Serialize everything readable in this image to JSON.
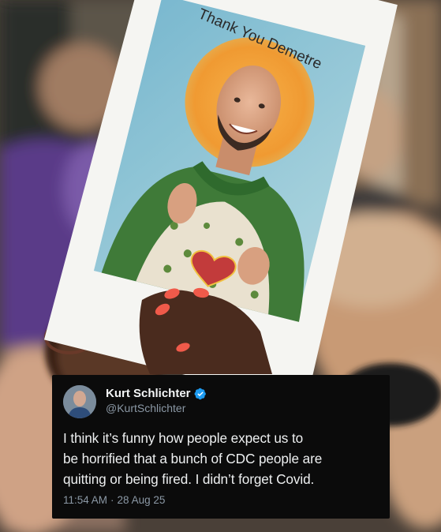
{
  "sign": {
    "caption": "Thank You Demetre"
  },
  "tweet": {
    "display_name": "Kurt Schlichter",
    "handle": "@KurtSchlichter",
    "verified_icon": "verified-badge-icon",
    "text": "I think it’s funny how people expect us to\nbe horrified that a bunch of CDC people are\nquitting or being fired. I didn’t forget Covid.",
    "time": "11:54 AM",
    "separator": "·",
    "date": "28 Aug 25"
  },
  "colors": {
    "tweet_bg": "#0b0b0b",
    "verified_blue": "#1d9bf0",
    "handle_gray": "#8b98a5",
    "robe_green": "#3f7a38",
    "halo_orange": "#f2a13a",
    "sign_blue": "#8ec3d8"
  }
}
